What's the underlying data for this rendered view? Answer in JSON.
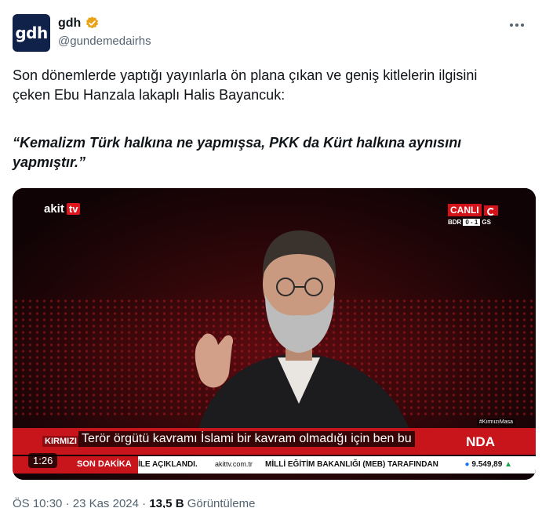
{
  "author": {
    "avatar_text": "gdh",
    "display_name": "gdh",
    "handle": "@gundemedairhs",
    "verified_color": "#e8a317"
  },
  "tweet": {
    "text": "Son dönemlerde yaptığı yayınlarla ön plana çıkan ve geniş kitlelerin ilgisini çeken Ebu Hanzala lakaplı Halis Bayancuk:",
    "quote": "“Kemalizm Türk halkına ne yapmışsa, PKK da Kürt halkına aynısını yapmıştır.”"
  },
  "video": {
    "channel_logo_a": "akit",
    "channel_logo_b": "tv",
    "live_label": "CANLI",
    "score": {
      "home": "BDR",
      "result": "0 - 1",
      "away": "GS"
    },
    "hashtag": "#KırmızıMasa",
    "lower_third_tag": "KIRMIZI",
    "lower_third_suffix": "NDA",
    "subtitle": "Terör örgütü kavramı İslami bir kavram olmadığı için ben bu",
    "ticker": {
      "breaking_label": "SON DAKİKA",
      "item1": "İLE AÇIKLANDI.",
      "site": "akittv.com.tr",
      "item2": "MİLLİ EĞİTİM BAKANLIĞI (MEB) TARAFINDAN",
      "market": "9.549,89"
    },
    "duration": "1:26",
    "accent_red": "#c8141b"
  },
  "meta": {
    "time": "ÖS 10:30",
    "separator": "·",
    "date": "23 Kas 2024",
    "views_count": "13,5 B",
    "views_label": "Görüntüleme"
  }
}
